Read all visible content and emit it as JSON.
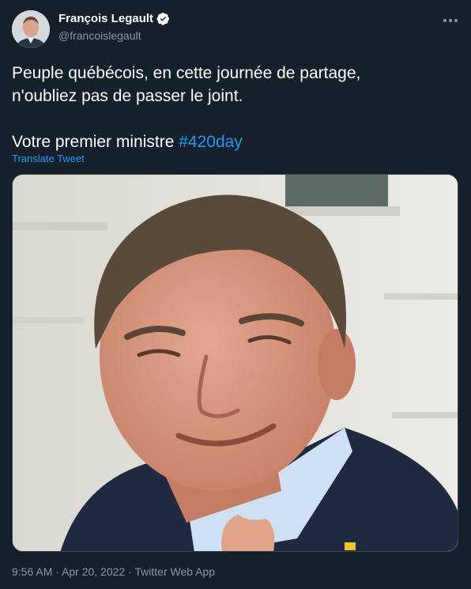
{
  "author": {
    "name": "François Legault",
    "handle": "@francoislegault",
    "verified": true
  },
  "tweet": {
    "line1": "Peuple québécois, en cette journée de partage,",
    "line2": "n'oubliez pas de passer le joint.",
    "line3_text": "Votre premier ministre ",
    "hashtag": "#420day",
    "translate_label": "Translate Tweet"
  },
  "meta": {
    "timestamp": "9:56 AM · Apr 20, 2022 · Twitter Web App"
  },
  "icons": {
    "verified": "verified-badge-icon",
    "more": "more-options-icon"
  },
  "colors": {
    "background": "#15202b",
    "accent": "#1d9bf0",
    "secondary_text": "#8b98a5"
  }
}
